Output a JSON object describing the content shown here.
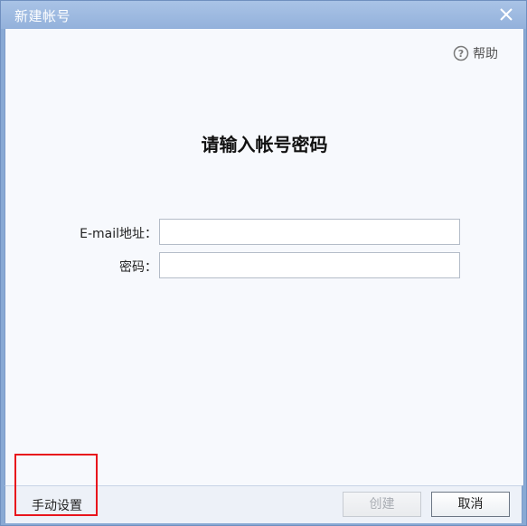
{
  "window": {
    "title": "新建帐号",
    "close_icon": "close-x-icon"
  },
  "help": {
    "icon": "question-circle-icon",
    "label": "帮助"
  },
  "form": {
    "heading": "请输入帐号密码",
    "email_label": "E-mail地址：",
    "email_value": "",
    "password_label": "密码：",
    "password_value": ""
  },
  "footer": {
    "manual_setup_label": "手动设置",
    "create_label": "创建",
    "cancel_label": "取消"
  },
  "colors": {
    "titlebar": "#a9c3e6",
    "highlight": "#e8141c",
    "disabled_text": "#a9adb3"
  }
}
